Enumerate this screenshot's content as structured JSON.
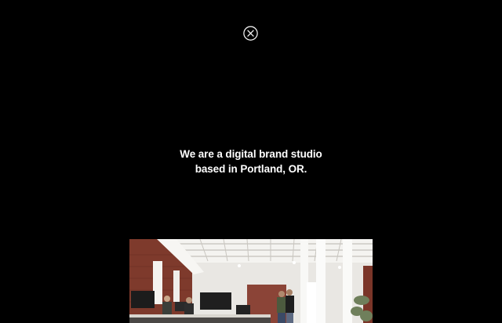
{
  "overlay": {
    "close_icon": "close-circle-x-icon",
    "tagline_line1": "We are a digital brand studio",
    "tagline_line2": "based in Portland, OR.",
    "photo_alt": "studio-office-photo"
  },
  "colors": {
    "background": "#000000",
    "text": "#ffffff",
    "brick": "#8a3b2e",
    "ceiling": "#f2f1ee"
  }
}
